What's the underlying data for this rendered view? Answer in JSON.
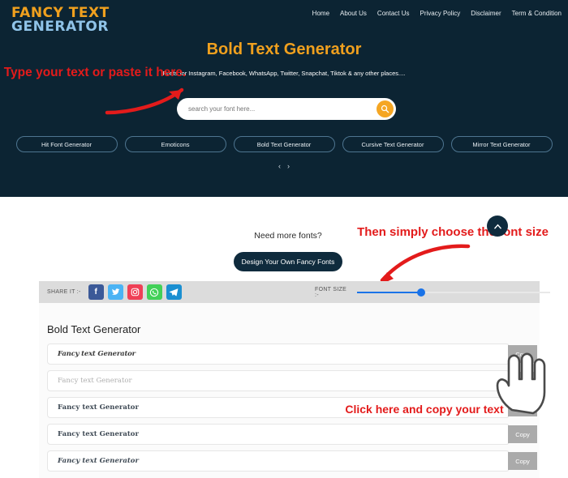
{
  "header": {
    "logo_line1": "FANCY TEXT",
    "logo_line2": "GENERATOR",
    "logo_color1": "#f0a01e",
    "logo_color2": "#8fc3e8",
    "background": "#0c2433",
    "nav": [
      {
        "label": "Home"
      },
      {
        "label": "About Us"
      },
      {
        "label": "Contact Us"
      },
      {
        "label": "Privacy Policy"
      },
      {
        "label": "Disclaimer"
      },
      {
        "label": "Term & Condition"
      }
    ]
  },
  "hero": {
    "title": "Bold Text Generator",
    "title_color": "#f0a01e",
    "subtitle": "Fonts for Instagram, Facebook, WhatsApp, Twitter, Snapchat, Tiktok & any other places....",
    "search_placeholder": "search your font here...",
    "search_value": "",
    "search_icon": "search-icon",
    "search_button_color": "#f5a623",
    "categories": [
      {
        "label": "Hit Font Generator"
      },
      {
        "label": "Emoticons"
      },
      {
        "label": "Bold Text Generator"
      },
      {
        "label": "Cursive Text Generator"
      },
      {
        "label": "Mirror Text Generator"
      }
    ],
    "carousel_prev": "‹",
    "carousel_next": "›"
  },
  "annotations": {
    "first": "Type your text or paste it here.",
    "second": "Then simply choose the font size",
    "third": "Click here and copy your text",
    "color": "#e31b1b"
  },
  "promo": {
    "question": "Need more fonts?",
    "button_label": "Design Your Own Fancy Fonts"
  },
  "scroll_top": {
    "icon": "chevron-up-icon",
    "label": "▲"
  },
  "toolbar": {
    "share_label": "SHARE IT :-",
    "socials": [
      {
        "name": "facebook-icon",
        "glyph": "f",
        "color": "#3b5998"
      },
      {
        "name": "twitter-icon",
        "glyph": "ᴛ",
        "color": "#4ab3f4"
      },
      {
        "name": "instagram-icon",
        "glyph": "◎",
        "color": "#ef4056"
      },
      {
        "name": "whatsapp-icon",
        "glyph": "✆",
        "color": "#42d158"
      },
      {
        "name": "telegram-icon",
        "glyph": "➤",
        "color": "#1a8fd1"
      }
    ],
    "font_size_label": "FONT SIZE :-",
    "font_size_percent": 33,
    "slider_color": "#1a73e8"
  },
  "results": {
    "heading": "Bold Text Generator",
    "copy_label": "Copy",
    "rows": [
      {
        "text": "Fancy text Generator",
        "style": "f-fraktur"
      },
      {
        "text": "Fancy text Generator",
        "style": "f-light"
      },
      {
        "text": "Fancy text Generator",
        "style": "f-bold"
      },
      {
        "text": "Fancy text Generator",
        "style": "f-bold"
      },
      {
        "text": "Fancy text Generator",
        "style": "f-bolditalic"
      }
    ]
  }
}
